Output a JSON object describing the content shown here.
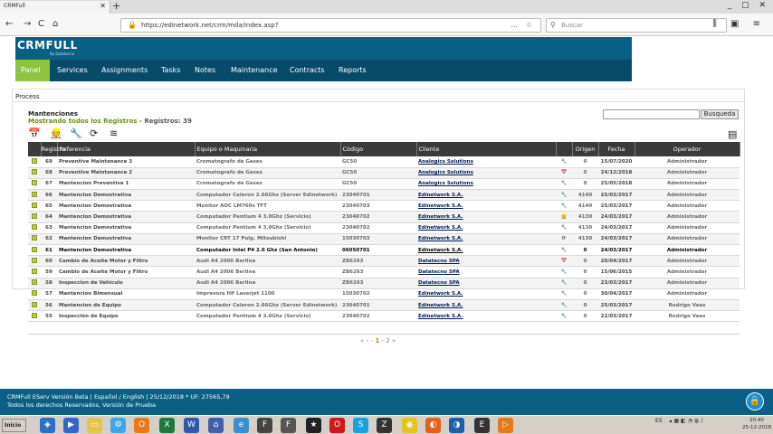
{
  "browser": {
    "tab_title": "CRMFull",
    "url": "https://edinetwork.net/crm/mda/index.asp?",
    "search_placeholder": "Buscar"
  },
  "app": {
    "logo": "CRMFULL",
    "logo_sub": "By Datatecno",
    "menu": [
      "Panel",
      "Services",
      "Assignments",
      "Tasks",
      "Notes",
      "Maintenance",
      "Contracts",
      "Reports"
    ],
    "active_menu": "Panel",
    "accent": "#8ec43f",
    "header_color": "#0a5f84"
  },
  "content": {
    "breadcrumb": "Process",
    "title": "Mantenciones",
    "subtitle": "Mostrando todos los Registros",
    "count_label": "- Registros: 39",
    "search_button": "Busqueda",
    "toolbar_icons": [
      "calendar-icon",
      "workers-icon",
      "person-tool-icon",
      "refresh-icon",
      "layers-icon"
    ]
  },
  "table": {
    "headers": [
      "Registro",
      "Referencia",
      "Equipo o Maquinaria",
      "Código",
      "Cliente",
      "Origen",
      "Fecha",
      "Operador"
    ],
    "rows": [
      {
        "reg": "69",
        "ref": "Preventive Maintenance 3",
        "equipo": "Cromatografo de Gases",
        "codigo": "GC50",
        "cliente": "Analogics Solutions",
        "icon": "🔧",
        "origen": "0",
        "fecha": "15/07/2020",
        "operador": "Administrador"
      },
      {
        "reg": "68",
        "ref": "Preventive Maintenance 2",
        "equipo": "Cromatografo de Gases",
        "codigo": "GC50",
        "cliente": "Analogics Solutions",
        "icon": "📅",
        "origen": "0",
        "fecha": "24/12/2018",
        "operador": "Administrador"
      },
      {
        "reg": "67",
        "ref": "Mantencion Preventiva 1",
        "equipo": "Cromatografo de Gases",
        "codigo": "GC50",
        "cliente": "Analogics Solutions",
        "icon": "🔧",
        "origen": "0",
        "fecha": "25/05/2018",
        "operador": "Administrador"
      },
      {
        "reg": "66",
        "ref": "Mantencion Demostrativa",
        "equipo": "Computador Celeron 2.66Ghz (Server Edinetwork)",
        "codigo": "23040701",
        "cliente": "Edinetwork S.A.",
        "icon": "🔧",
        "origen": "4140",
        "fecha": "25/03/2017",
        "operador": "Administrador"
      },
      {
        "reg": "65",
        "ref": "Mantencion Demostrativa",
        "equipo": "Monitor AOC LM760s TFT",
        "codigo": "23040703",
        "cliente": "Edinetwork S.A.",
        "icon": "🔧",
        "origen": "4140",
        "fecha": "25/03/2017",
        "operador": "Administrador"
      },
      {
        "reg": "64",
        "ref": "Mantencion Demostrativa",
        "equipo": "Computador Pentium 4 3.0Ghz (Servicio)",
        "codigo": "23040702",
        "cliente": "Edinetwork S.A.",
        "icon": "👷",
        "origen": "4130",
        "fecha": "24/03/2017",
        "operador": "Administrador"
      },
      {
        "reg": "63",
        "ref": "Mantencion Demostrativa",
        "equipo": "Computador Pentium 4 3.0Ghz (Servicio)",
        "codigo": "23040702",
        "cliente": "Edinetwork S.A.",
        "icon": "🔧",
        "origen": "4130",
        "fecha": "24/03/2017",
        "operador": "Administrador"
      },
      {
        "reg": "62",
        "ref": "Mantencion Demostrativa",
        "equipo": "Monitor CRT 17 Pulg. Mitsubishi",
        "codigo": "15030703",
        "cliente": "Edinetwork S.A.",
        "icon": "⟳",
        "origen": "4130",
        "fecha": "24/03/2017",
        "operador": "Administrador"
      },
      {
        "reg": "61",
        "ref": "Mantencion Demostrativa",
        "equipo": "Computador Intel P4 2.0 Ghz (San Antonio)",
        "codigo": "06050701",
        "cliente": "Edinetwork S.A.",
        "icon": "🔧",
        "origen": "0",
        "fecha": "24/03/2017",
        "operador": "Administrador"
      },
      {
        "reg": "60",
        "ref": "Cambio de Aceite Motor y Filtro",
        "equipo": "Audi A4 2006 Berlina",
        "codigo": "ZB6263",
        "cliente": "Datatecno SPA",
        "icon": "📅",
        "origen": "0",
        "fecha": "20/04/2017",
        "operador": "Administrador"
      },
      {
        "reg": "59",
        "ref": "Cambio de Aceite Motor y Filtro",
        "equipo": "Audi A4 2006 Berlina",
        "codigo": "ZB6263",
        "cliente": "Datatecno SPA",
        "icon": "🔧",
        "origen": "0",
        "fecha": "15/06/2015",
        "operador": "Administrador"
      },
      {
        "reg": "58",
        "ref": "Inspeccion de Vehiculo",
        "equipo": "Audi A4 2006 Berlina",
        "codigo": "ZB6263",
        "cliente": "Datatecno SPA",
        "icon": "🔧",
        "origen": "0",
        "fecha": "23/03/2017",
        "operador": "Administrador"
      },
      {
        "reg": "57",
        "ref": "Mantencion Bimensual",
        "equipo": "Impresora HP Laserjet 1100",
        "codigo": "15030702",
        "cliente": "Edinetwork S.A.",
        "icon": "🔧",
        "origen": "0",
        "fecha": "30/04/2017",
        "operador": "Administrador"
      },
      {
        "reg": "56",
        "ref": "Mantencion de Equipo",
        "equipo": "Computador Celeron 2.66Ghz (Server Edinetwork)",
        "codigo": "23040701",
        "cliente": "Edinetwork S.A.",
        "icon": "🔧",
        "origen": "0",
        "fecha": "25/03/2017",
        "operador": "Rodrigo Veas"
      },
      {
        "reg": "55",
        "ref": "Inspección de Equipo",
        "equipo": "Computador Pentium 4 3.0Ghz (Servicio)",
        "codigo": "23040702",
        "cliente": "Edinetwork S.A.",
        "icon": "🔧",
        "origen": "0",
        "fecha": "22/03/2017",
        "operador": "Rodrigo Veas"
      }
    ]
  },
  "pager": {
    "prev": "«",
    "prev2": "‹",
    "current": "1",
    "next_page": "2",
    "next": "»"
  },
  "footer": {
    "line1": "CRMFull EServ Versión Beta | Español / English | 25/12/2018 * UF: 27565,79",
    "line2": "Todos los derechos Reservados, Versión de Prueba"
  },
  "taskbar": {
    "start": "Inicio",
    "lang": "ES",
    "time": "20:40",
    "date": "25-12-2018"
  }
}
